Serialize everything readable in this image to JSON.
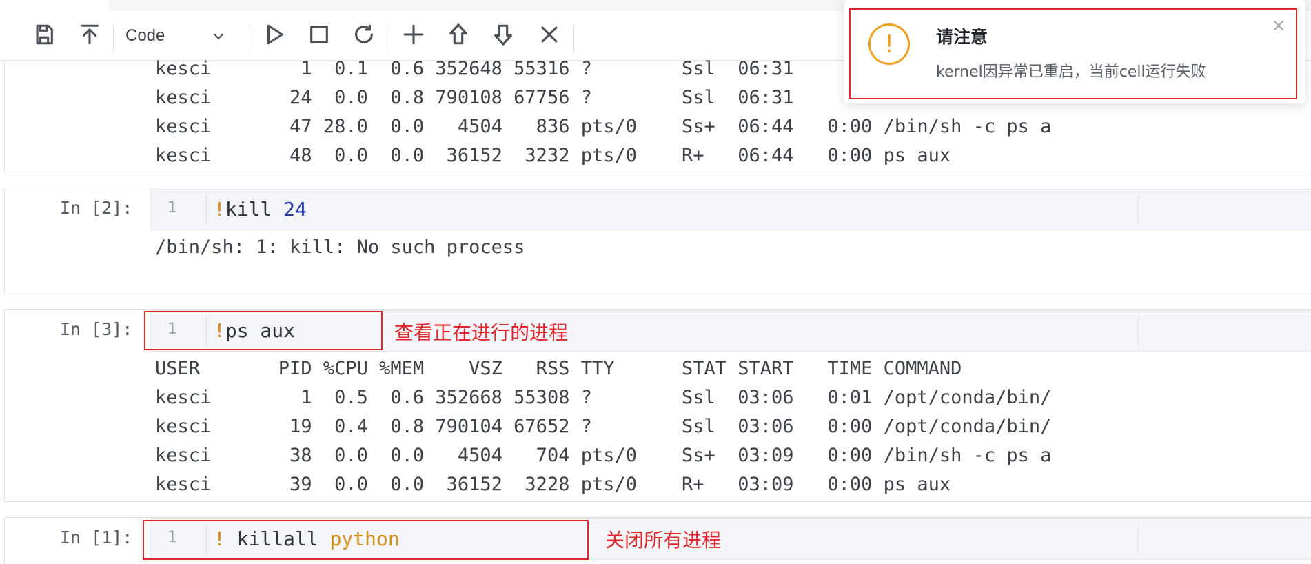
{
  "toolbar": {
    "cell_type": "Code",
    "icons": [
      "save-icon",
      "move-top-icon",
      "chevron-down-icon",
      "run-icon",
      "stop-icon",
      "restart-icon",
      "add-icon",
      "move-up-icon",
      "move-down-icon",
      "delete-icon"
    ]
  },
  "cells": [
    {
      "output": [
        "kesci        1  0.1  0.6 352648 55316 ?        Ssl  06:31",
        "kesci       24  0.0  0.8 790108 67756 ?        Ssl  06:31",
        "kesci       47 28.0  0.0   4504   836 pts/0    Ss+  06:44   0:00 /bin/sh -c ps a",
        "kesci       48  0.0  0.0  36152  3232 pts/0    R+   06:44   0:00 ps aux"
      ]
    },
    {
      "prompt": "In [2]:",
      "line_number": "1",
      "code_bang": "!",
      "code_cmd": "kill ",
      "code_arg": "24",
      "output": [
        "/bin/sh: 1: kill: No such process"
      ]
    },
    {
      "prompt": "In [3]:",
      "line_number": "1",
      "code_bang": "!",
      "code_cmd": "ps aux",
      "annotation": "查看正在进行的进程",
      "output": [
        "USER       PID %CPU %MEM    VSZ   RSS TTY      STAT START   TIME COMMAND",
        "kesci        1  0.5  0.6 352668 55308 ?        Ssl  03:06   0:01 /opt/conda/bin/",
        "kesci       19  0.4  0.8 790104 67652 ?        Ssl  03:06   0:00 /opt/conda/bin/",
        "kesci       38  0.0  0.0   4504   704 pts/0    Ss+  03:09   0:00 /bin/sh -c ps a",
        "kesci       39  0.0  0.0  36152  3228 pts/0    R+   03:09   0:00 ps aux"
      ]
    },
    {
      "prompt": "In [1]:",
      "line_number": "1",
      "code_bang": "!",
      "code_cmd": " killall ",
      "code_arg": "python",
      "annotation": "关闭所有进程"
    }
  ],
  "notification": {
    "title": "请注意",
    "message": "kernel因异常已重启，当前cell运行失败",
    "icon": "warning-icon"
  },
  "colors": {
    "accent_red": "#e0262b",
    "warning_orange": "#f0a020",
    "code_keyword": "#d4901b",
    "code_number": "#1f35a8"
  }
}
